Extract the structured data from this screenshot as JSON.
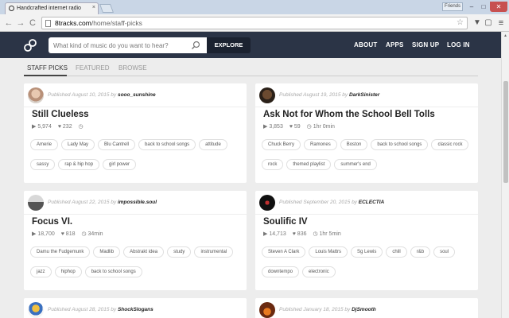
{
  "browser": {
    "tab_title": "Handcrafted internet radio",
    "tab_close": "×",
    "user_label": "Friends",
    "url_host": "8tracks.com",
    "url_path": "/home/staff-picks",
    "nav_back": "←",
    "nav_forward": "→",
    "nav_reload": "C",
    "star": "☆",
    "ext1": "▼",
    "ext2": "▢",
    "menu": "≡",
    "win_min": "–",
    "win_max": "□",
    "win_close": "✕"
  },
  "header": {
    "search_placeholder": "What kind of music do you want to hear?",
    "explore_label": "EXPLORE",
    "nav": {
      "about": "ABOUT",
      "apps": "APPS",
      "signup": "SIGN UP",
      "login": "LOG IN"
    }
  },
  "tabs": {
    "staff_picks": "STAFF PICKS",
    "featured": "FEATURED",
    "browse": "BROWSE"
  },
  "cards": [
    {
      "published": "Published August 10, 2015 by",
      "user": "sooo_sunshine",
      "title": "Still Clueless",
      "plays": "▶ 5,974",
      "likes": "♥ 232",
      "duration": "◷",
      "tags": [
        "Amerie",
        "Lady May",
        "Blu Cantrell",
        "back to school songs",
        "attitude",
        "sassy",
        "rap & hip hop",
        "girl power"
      ]
    },
    {
      "published": "Published August 19, 2015 by",
      "user": "DarkSinister",
      "title": "Ask Not for Whom the School Bell Tolls",
      "plays": "▶ 3,853",
      "likes": "♥ 59",
      "duration": "◷ 1hr 0min",
      "tags": [
        "Chuck Berry",
        "Ramones",
        "Boston",
        "back to school songs",
        "classic rock",
        "rock",
        "themed playlist",
        "summer's end"
      ]
    },
    {
      "published": "Published August 22, 2015 by",
      "user": "impossible.soul",
      "title": "Focus VI.",
      "plays": "▶ 18,700",
      "likes": "♥ 818",
      "duration": "◷ 34min",
      "tags": [
        "Damu the Fudgemunk",
        "Madlib",
        "Abstrakt idea",
        "study",
        "instrumental",
        "jazz",
        "hiphop",
        "back to school songs"
      ]
    },
    {
      "published": "Published September 20, 2015 by",
      "user": "ECLECTIA",
      "title": "Soulific IV",
      "plays": "▶ 14,713",
      "likes": "♥ 836",
      "duration": "◷ 1hr 5min",
      "tags": [
        "Steven A Clark",
        "Louis Mattrs",
        "Sg Lewis",
        "chill",
        "r&b",
        "soul",
        "downtempo",
        "electronic"
      ]
    },
    {
      "published": "Published August 28, 2015 by",
      "user": "ShockSlogans",
      "title": "",
      "plays": "",
      "likes": "",
      "duration": "",
      "tags": []
    },
    {
      "published": "Published January 18, 2015 by",
      "user": "DjSmooth",
      "title": "",
      "plays": "",
      "likes": "",
      "duration": "",
      "tags": []
    }
  ],
  "colors": {
    "header_bg": "#2b3446",
    "page_bg": "#ededed"
  }
}
